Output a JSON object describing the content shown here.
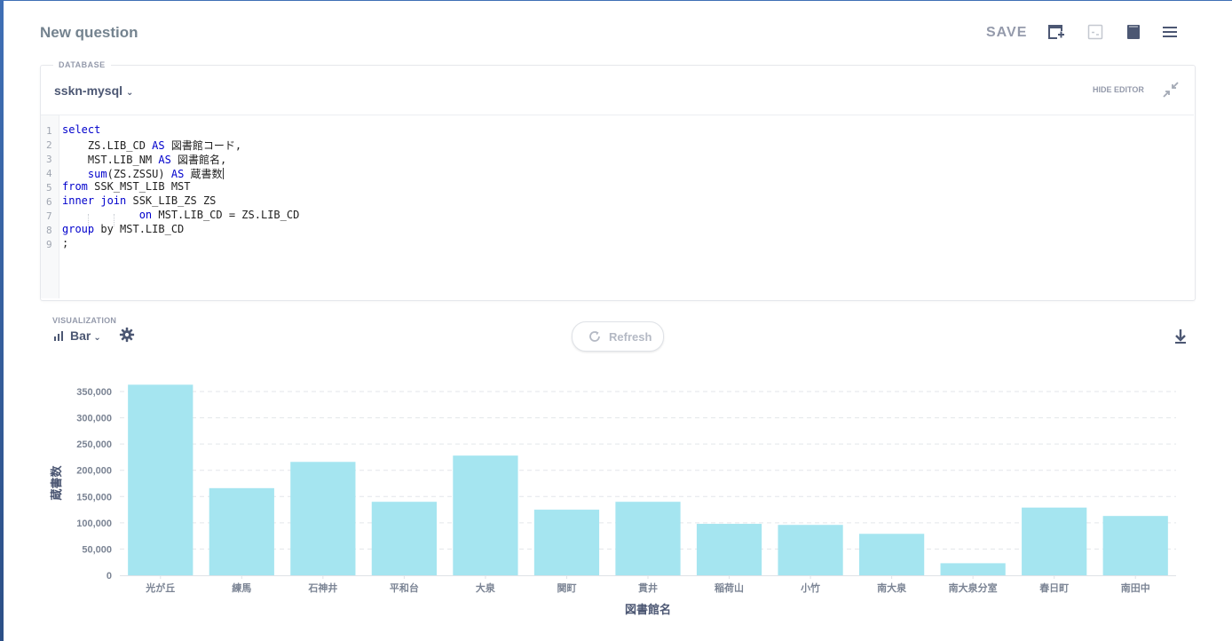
{
  "header": {
    "title": "New question",
    "save_label": "SAVE",
    "icons": [
      "add-to-dashboard-icon",
      "embed-icon",
      "bookmark-icon",
      "menu-icon"
    ]
  },
  "editor": {
    "database_label": "DATABASE",
    "database_value": "sskn-mysql",
    "hide_editor_label": "HIDE EDITOR",
    "line_numbers": [
      "1",
      "2",
      "3",
      "4",
      "5",
      "6",
      "7",
      "8",
      "9"
    ],
    "code_lines": [
      [
        {
          "t": "select",
          "k": true
        }
      ],
      [
        {
          "t": "    ZS.LIB_CD "
        },
        {
          "t": "AS",
          "k": true
        },
        {
          "t": " 図書館コード,"
        }
      ],
      [
        {
          "t": "    MST.LIB_NM "
        },
        {
          "t": "AS",
          "k": true
        },
        {
          "t": " 図書館名,"
        }
      ],
      [
        {
          "t": "    "
        },
        {
          "t": "sum",
          "k": true
        },
        {
          "t": "(ZS.ZSSU) "
        },
        {
          "t": "AS",
          "k": true
        },
        {
          "t": " 蔵書数"
        },
        {
          "caret": true
        }
      ],
      [
        {
          "t": "from",
          "k": true
        },
        {
          "t": " SSK_MST_LIB MST"
        }
      ],
      [
        {
          "t": "inner join",
          "k": true
        },
        {
          "t": " SSK_LIB_ZS ZS"
        }
      ],
      [
        {
          "t": "            "
        },
        {
          "t": "on",
          "k": true
        },
        {
          "t": " MST.LIB_CD = ZS.LIB_CD"
        }
      ],
      [
        {
          "t": "group",
          "k": true
        },
        {
          "t": " by MST.LIB_CD"
        }
      ],
      [
        {
          "t": ";"
        }
      ]
    ]
  },
  "visualization": {
    "label": "VISUALIZATION",
    "type": "Bar",
    "refresh_label": "Refresh"
  },
  "colors": {
    "bar": "#a5e5f0",
    "grid": "#e3e6ea",
    "keyword": "#0000cc"
  },
  "chart_data": {
    "type": "bar",
    "categories": [
      "光が丘",
      "練馬",
      "石神井",
      "平和台",
      "大泉",
      "関町",
      "貫井",
      "稲荷山",
      "小竹",
      "南大泉",
      "南大泉分室",
      "春日町",
      "南田中"
    ],
    "values": [
      363000,
      166000,
      216000,
      140000,
      228000,
      125000,
      140000,
      98000,
      96000,
      79000,
      23000,
      129000,
      113000
    ],
    "xlabel": "図書館名",
    "ylabel": "蔵書数",
    "ylim": [
      0,
      350000
    ],
    "yticks": [
      0,
      50000,
      100000,
      150000,
      200000,
      250000,
      300000,
      350000
    ],
    "ytick_labels": [
      "0",
      "50,000",
      "100,000",
      "150,000",
      "200,000",
      "250,000",
      "300,000",
      "350,000"
    ],
    "grid": true,
    "legend": "none"
  }
}
